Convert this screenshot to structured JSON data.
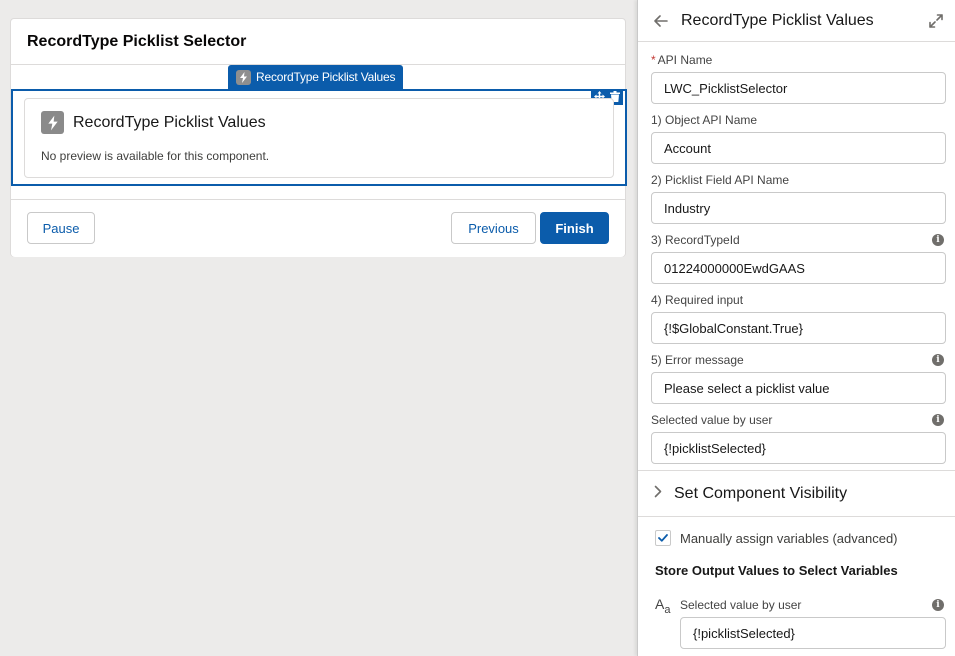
{
  "canvas": {
    "screen_title": "RecordType Picklist Selector",
    "component_tab_label": "RecordType Picklist Values",
    "component": {
      "title": "RecordType Picklist Values",
      "preview_text": "No preview is available for this component.",
      "icon": "lightning-bolt-icon"
    },
    "footer": {
      "pause_label": "Pause",
      "previous_label": "Previous",
      "finish_label": "Finish"
    }
  },
  "panel": {
    "title": "RecordType Picklist Values",
    "fields": [
      {
        "label": "API Name",
        "required": true,
        "value": "LWC_PicklistSelector",
        "info": false
      },
      {
        "label": "1) Object API Name",
        "required": false,
        "value": "Account",
        "info": false
      },
      {
        "label": "2) Picklist Field API Name",
        "required": false,
        "value": "Industry",
        "info": false
      },
      {
        "label": "3) RecordTypeId",
        "required": false,
        "value": "01224000000EwdGAAS",
        "info": true
      },
      {
        "label": "4) Required input",
        "required": false,
        "value": "{!$GlobalConstant.True}",
        "info": false
      },
      {
        "label": "5) Error message",
        "required": false,
        "value": "Please select a picklist value",
        "info": true
      },
      {
        "label": "Selected value by user",
        "required": false,
        "value": "{!picklistSelected}",
        "info": true
      }
    ],
    "visibility_section_label": "Set Component Visibility",
    "manual_assign_label": "Manually assign variables (advanced)",
    "manual_assign_checked": true,
    "store_output_title": "Store Output Values to Select Variables",
    "output_field": {
      "label": "Selected value by user",
      "value": "{!picklistSelected}",
      "info": true
    }
  },
  "colors": {
    "brand": "#0b5cab",
    "canvas_bg": "#ecebea",
    "required": "#c23934"
  }
}
